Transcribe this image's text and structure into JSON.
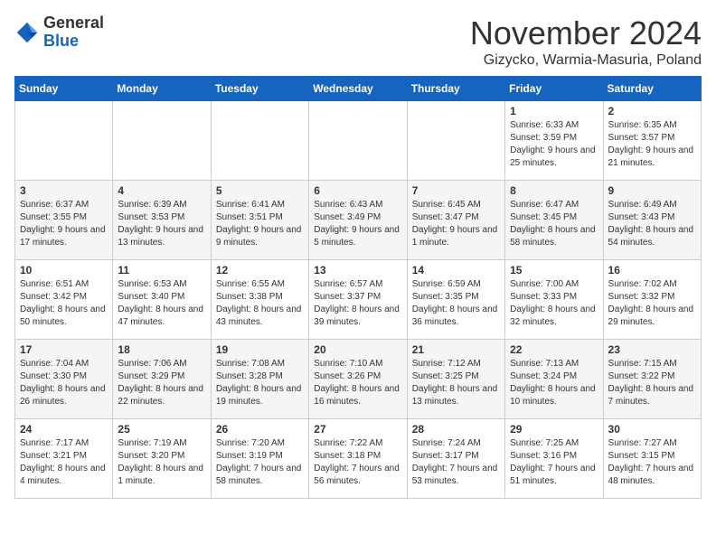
{
  "header": {
    "logo_general": "General",
    "logo_blue": "Blue",
    "month_title": "November 2024",
    "location": "Gizycko, Warmia-Masuria, Poland"
  },
  "days_of_week": [
    "Sunday",
    "Monday",
    "Tuesday",
    "Wednesday",
    "Thursday",
    "Friday",
    "Saturday"
  ],
  "weeks": [
    [
      {
        "day": "",
        "info": ""
      },
      {
        "day": "",
        "info": ""
      },
      {
        "day": "",
        "info": ""
      },
      {
        "day": "",
        "info": ""
      },
      {
        "day": "",
        "info": ""
      },
      {
        "day": "1",
        "info": "Sunrise: 6:33 AM\nSunset: 3:59 PM\nDaylight: 9 hours and 25 minutes."
      },
      {
        "day": "2",
        "info": "Sunrise: 6:35 AM\nSunset: 3:57 PM\nDaylight: 9 hours and 21 minutes."
      }
    ],
    [
      {
        "day": "3",
        "info": "Sunrise: 6:37 AM\nSunset: 3:55 PM\nDaylight: 9 hours and 17 minutes."
      },
      {
        "day": "4",
        "info": "Sunrise: 6:39 AM\nSunset: 3:53 PM\nDaylight: 9 hours and 13 minutes."
      },
      {
        "day": "5",
        "info": "Sunrise: 6:41 AM\nSunset: 3:51 PM\nDaylight: 9 hours and 9 minutes."
      },
      {
        "day": "6",
        "info": "Sunrise: 6:43 AM\nSunset: 3:49 PM\nDaylight: 9 hours and 5 minutes."
      },
      {
        "day": "7",
        "info": "Sunrise: 6:45 AM\nSunset: 3:47 PM\nDaylight: 9 hours and 1 minute."
      },
      {
        "day": "8",
        "info": "Sunrise: 6:47 AM\nSunset: 3:45 PM\nDaylight: 8 hours and 58 minutes."
      },
      {
        "day": "9",
        "info": "Sunrise: 6:49 AM\nSunset: 3:43 PM\nDaylight: 8 hours and 54 minutes."
      }
    ],
    [
      {
        "day": "10",
        "info": "Sunrise: 6:51 AM\nSunset: 3:42 PM\nDaylight: 8 hours and 50 minutes."
      },
      {
        "day": "11",
        "info": "Sunrise: 6:53 AM\nSunset: 3:40 PM\nDaylight: 8 hours and 47 minutes."
      },
      {
        "day": "12",
        "info": "Sunrise: 6:55 AM\nSunset: 3:38 PM\nDaylight: 8 hours and 43 minutes."
      },
      {
        "day": "13",
        "info": "Sunrise: 6:57 AM\nSunset: 3:37 PM\nDaylight: 8 hours and 39 minutes."
      },
      {
        "day": "14",
        "info": "Sunrise: 6:59 AM\nSunset: 3:35 PM\nDaylight: 8 hours and 36 minutes."
      },
      {
        "day": "15",
        "info": "Sunrise: 7:00 AM\nSunset: 3:33 PM\nDaylight: 8 hours and 32 minutes."
      },
      {
        "day": "16",
        "info": "Sunrise: 7:02 AM\nSunset: 3:32 PM\nDaylight: 8 hours and 29 minutes."
      }
    ],
    [
      {
        "day": "17",
        "info": "Sunrise: 7:04 AM\nSunset: 3:30 PM\nDaylight: 8 hours and 26 minutes."
      },
      {
        "day": "18",
        "info": "Sunrise: 7:06 AM\nSunset: 3:29 PM\nDaylight: 8 hours and 22 minutes."
      },
      {
        "day": "19",
        "info": "Sunrise: 7:08 AM\nSunset: 3:28 PM\nDaylight: 8 hours and 19 minutes."
      },
      {
        "day": "20",
        "info": "Sunrise: 7:10 AM\nSunset: 3:26 PM\nDaylight: 8 hours and 16 minutes."
      },
      {
        "day": "21",
        "info": "Sunrise: 7:12 AM\nSunset: 3:25 PM\nDaylight: 8 hours and 13 minutes."
      },
      {
        "day": "22",
        "info": "Sunrise: 7:13 AM\nSunset: 3:24 PM\nDaylight: 8 hours and 10 minutes."
      },
      {
        "day": "23",
        "info": "Sunrise: 7:15 AM\nSunset: 3:22 PM\nDaylight: 8 hours and 7 minutes."
      }
    ],
    [
      {
        "day": "24",
        "info": "Sunrise: 7:17 AM\nSunset: 3:21 PM\nDaylight: 8 hours and 4 minutes."
      },
      {
        "day": "25",
        "info": "Sunrise: 7:19 AM\nSunset: 3:20 PM\nDaylight: 8 hours and 1 minute."
      },
      {
        "day": "26",
        "info": "Sunrise: 7:20 AM\nSunset: 3:19 PM\nDaylight: 7 hours and 58 minutes."
      },
      {
        "day": "27",
        "info": "Sunrise: 7:22 AM\nSunset: 3:18 PM\nDaylight: 7 hours and 56 minutes."
      },
      {
        "day": "28",
        "info": "Sunrise: 7:24 AM\nSunset: 3:17 PM\nDaylight: 7 hours and 53 minutes."
      },
      {
        "day": "29",
        "info": "Sunrise: 7:25 AM\nSunset: 3:16 PM\nDaylight: 7 hours and 51 minutes."
      },
      {
        "day": "30",
        "info": "Sunrise: 7:27 AM\nSunset: 3:15 PM\nDaylight: 7 hours and 48 minutes."
      }
    ]
  ]
}
